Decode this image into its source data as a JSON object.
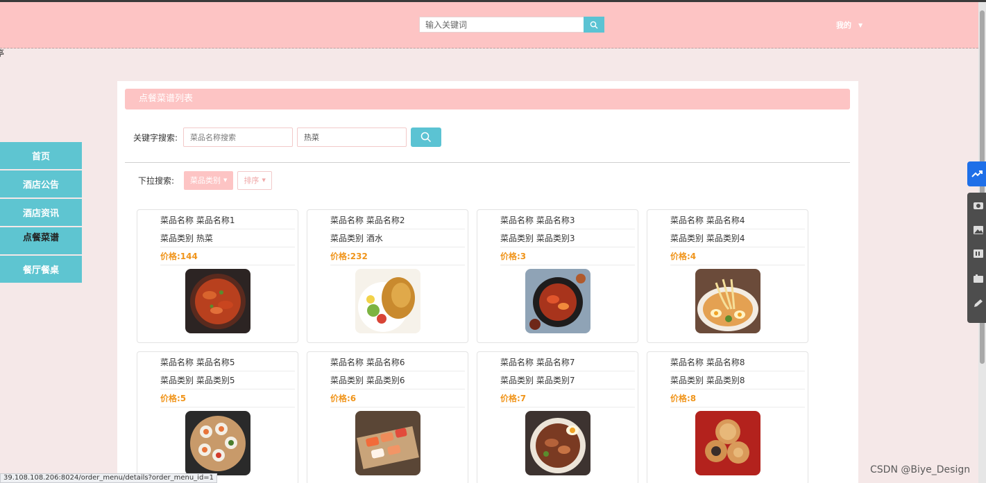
{
  "colors": {
    "header_bg": "#fdc4c4",
    "accent_cyan": "#5bc3d3",
    "price_orange": "#f0951c",
    "page_bg": "#f5e8e8"
  },
  "header": {
    "search_placeholder": "输入关键词",
    "user_menu_label": "我的"
  },
  "stray_text": "亭",
  "sidebar": {
    "items": [
      {
        "label": "首页"
      },
      {
        "label": "酒店公告"
      },
      {
        "label": "酒店资讯"
      },
      {
        "label": "点餐菜谱"
      },
      {
        "label": "餐厅餐桌"
      }
    ]
  },
  "panel": {
    "title": "点餐菜谱列表",
    "keyword_label": "关键字搜索:",
    "name_placeholder": "菜品名称搜索",
    "category_value": "热菜",
    "dropdown_label": "下拉搜索:",
    "category_dropdown": "菜品类别",
    "sort_dropdown": "排序"
  },
  "dishes": [
    {
      "name": "菜品名称 菜品名称1",
      "category": "菜品类别 热菜",
      "price": "价格:144",
      "image": "red-stew-dish"
    },
    {
      "name": "菜品名称 菜品名称2",
      "category": "菜品类别 酒水",
      "price": "价格:232",
      "image": "fried-chicken-salad"
    },
    {
      "name": "菜品名称 菜品名称3",
      "category": "菜品类别 菜品类别3",
      "price": "价格:3",
      "image": "spicy-dish-dark-bowl"
    },
    {
      "name": "菜品名称 菜品名称4",
      "category": "菜品类别 菜品类别4",
      "price": "价格:4",
      "image": "ramen-bowl"
    },
    {
      "name": "菜品名称 菜品名称5",
      "category": "菜品类别 菜品类别5",
      "price": "价格:5",
      "image": "sushi-rolls-plate"
    },
    {
      "name": "菜品名称 菜品名称6",
      "category": "菜品类别 菜品类别6",
      "price": "价格:6",
      "image": "sashimi-board"
    },
    {
      "name": "菜品名称 菜品名称7",
      "category": "菜品类别 菜品类别7",
      "price": "价格:7",
      "image": "noodle-bowl-egg"
    },
    {
      "name": "菜品名称 菜品名称8",
      "category": "菜品类别 菜品类别8",
      "price": "价格:8",
      "image": "pastry-cookies"
    }
  ],
  "status_bar": {
    "url": "39.108.108.206:8024/order_menu/details?order_menu_id=1"
  },
  "watermark": "CSDN @Biye_Design"
}
